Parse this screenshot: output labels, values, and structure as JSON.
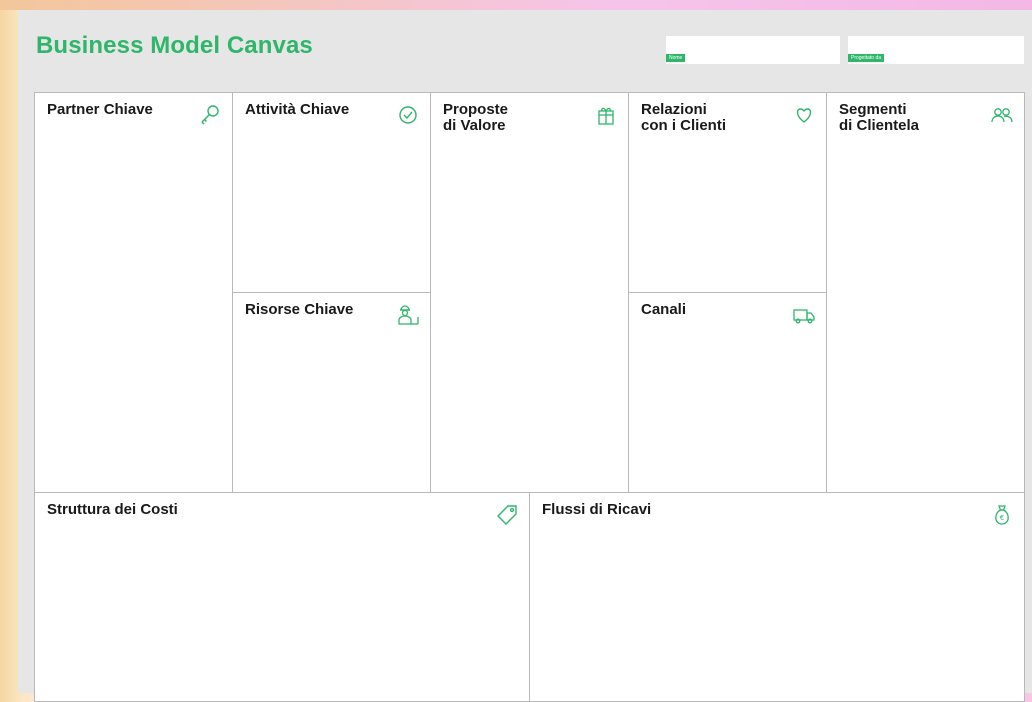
{
  "canvas": {
    "title": "Business Model Canvas",
    "fields": [
      {
        "label": "Nome"
      },
      {
        "label": "Progettato da"
      }
    ]
  },
  "blocks": {
    "partner": {
      "label": "Partner Chiave",
      "icon": "key-icon"
    },
    "attivita": {
      "label": "Attività Chiave",
      "icon": "check-circle-icon"
    },
    "risorse": {
      "label": "Risorse Chiave",
      "icon": "worker-icon"
    },
    "proposte": {
      "label": "Proposte\ndi Valore",
      "icon": "gift-icon"
    },
    "relazioni": {
      "label": "Relazioni\ncon i Clienti",
      "icon": "heart-icon"
    },
    "canali": {
      "label": "Canali",
      "icon": "truck-icon"
    },
    "segmenti": {
      "label": "Segmenti\ndi Clientela",
      "icon": "people-icon"
    },
    "costi": {
      "label": "Struttura dei Costi",
      "icon": "tag-icon"
    },
    "ricavi": {
      "label": "Flussi di Ricavi",
      "icon": "money-bag-icon"
    }
  },
  "colors": {
    "accent": "#2fb66a",
    "background": "#e6e6e6",
    "border": "#b9b9b9"
  }
}
